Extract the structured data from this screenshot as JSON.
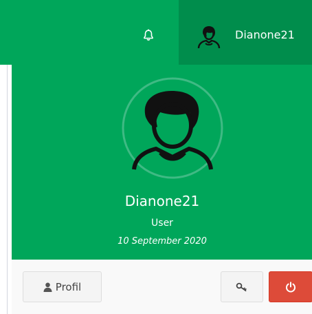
{
  "navbar": {
    "username": "Dianone21",
    "icons": {
      "notifications": "bell-icon",
      "avatar": "user-avatar-icon"
    }
  },
  "user_header": {
    "name": "Dianone21",
    "role": "User",
    "member_since": "10 September 2020"
  },
  "user_footer": {
    "profile_label": "Profil",
    "icons": {
      "profile": "user-icon",
      "change_password": "key-icon",
      "logout": "power-icon"
    }
  },
  "colors": {
    "header_green": "#00a65a",
    "header_green_dark": "#008d4c",
    "danger_red": "#dd4b39"
  }
}
